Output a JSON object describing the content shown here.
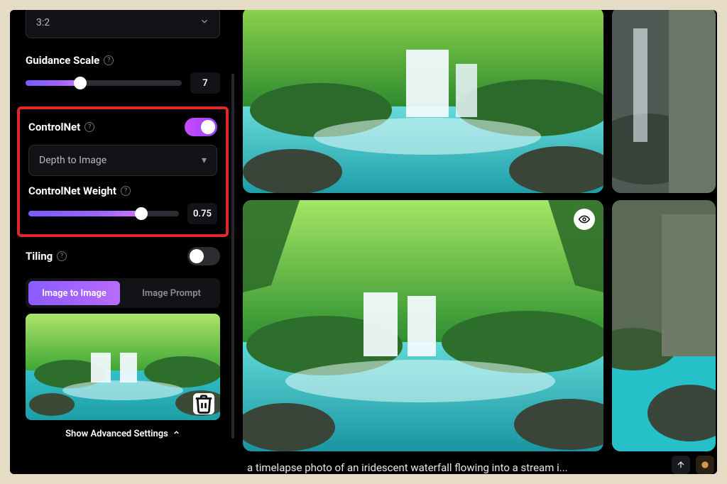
{
  "sidebar": {
    "aspect_ratio": {
      "value": "3:2"
    },
    "guidance_scale": {
      "label": "Guidance Scale",
      "value": "7",
      "fill_pct": 35
    },
    "controlnet": {
      "label": "ControlNet",
      "enabled": true,
      "mode_value": "Depth to Image",
      "weight": {
        "label": "ControlNet Weight",
        "value": "0.75",
        "fill_pct": 75
      }
    },
    "tiling": {
      "label": "Tiling",
      "enabled": false
    },
    "tabs": {
      "image_to_image": "Image to Image",
      "image_prompt": "Image Prompt",
      "active": "image_to_image"
    },
    "advanced_label": "Show Advanced Settings"
  },
  "main": {
    "prompt_text": "a timelapse photo of an iridescent waterfall flowing into a stream i..."
  }
}
